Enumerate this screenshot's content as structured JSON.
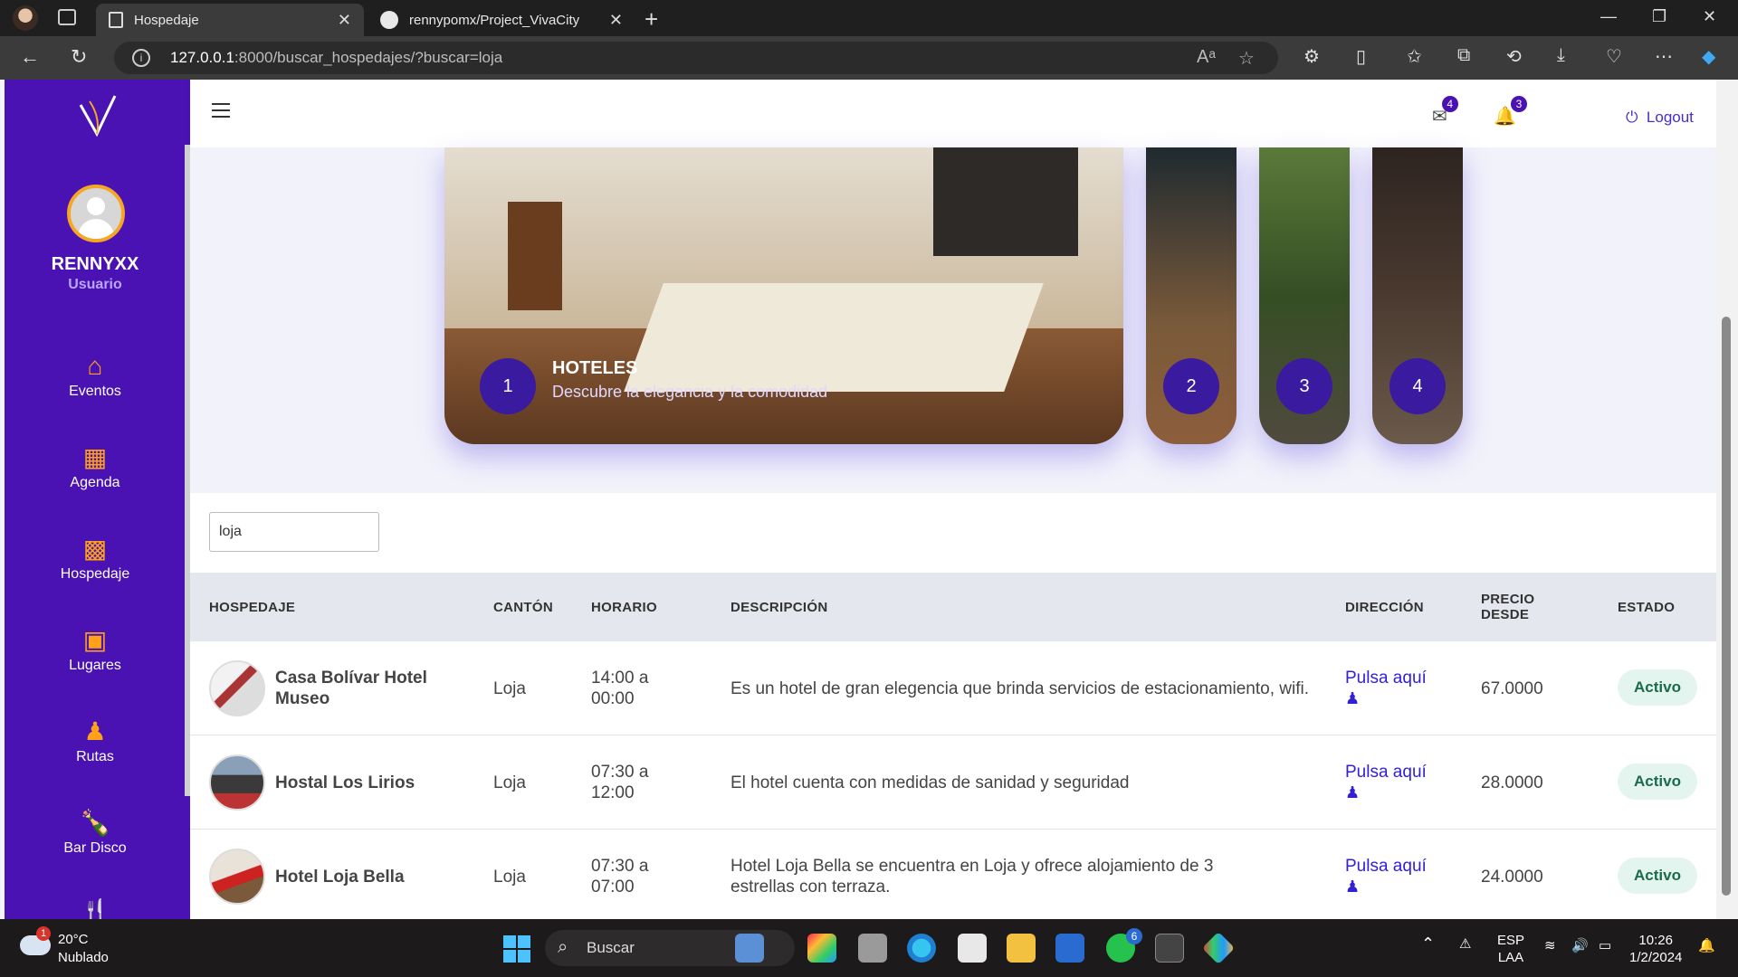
{
  "browser": {
    "tabs": [
      {
        "title": "Hospedaje",
        "active": true
      },
      {
        "title": "rennypomx/Project_VivaCity",
        "active": false
      }
    ],
    "url_host": "127.0.0.1",
    "url_path": ":8000/buscar_hospedajes/?buscar=loja"
  },
  "sidebar": {
    "user_name": "RENNYXX",
    "user_role": "Usuario",
    "items": [
      {
        "label": "Eventos",
        "icon": "home-icon"
      },
      {
        "label": "Agenda",
        "icon": "calendar-icon"
      },
      {
        "label": "Hospedaje",
        "icon": "building-icon"
      },
      {
        "label": "Lugares",
        "icon": "image-icon"
      },
      {
        "label": "Rutas",
        "icon": "route-icon"
      },
      {
        "label": "Bar Disco",
        "icon": "bottle-icon"
      }
    ]
  },
  "topbar": {
    "messages_count": "4",
    "notifications_count": "3",
    "logout_label": "Logout"
  },
  "hero": {
    "title": "HOTELES",
    "subtitle": "Descubre la elegancia y la comodidad",
    "slides": [
      "1",
      "2",
      "3",
      "4"
    ]
  },
  "search": {
    "value": "loja"
  },
  "table": {
    "headers": [
      "HOSPEDAJE",
      "CANTÓN",
      "HORARIO",
      "DESCRIPCIÓN",
      "DIRECCIÓN",
      "PRECIO DESDE",
      "ESTADO"
    ],
    "rows": [
      {
        "name": "Casa Bolívar Hotel Museo",
        "canton": "Loja",
        "horario": "14:00 a 00:00",
        "descripcion": "Es un hotel de gran elegencia que brinda servicios de estacionamiento, wifi.",
        "direccion": "Pulsa aquí",
        "precio": "67.0000",
        "estado": "Activo"
      },
      {
        "name": "Hostal Los Lirios",
        "canton": "Loja",
        "horario": "07:30 a 12:00",
        "descripcion": "El hotel cuenta con medidas de sanidad y seguridad",
        "direccion": "Pulsa aquí",
        "precio": "28.0000",
        "estado": "Activo"
      },
      {
        "name": "Hotel Loja Bella",
        "canton": "Loja",
        "horario": "07:30 a 07:00",
        "descripcion": "Hotel Loja Bella se encuentra en Loja y ofrece alojamiento de 3 estrellas con terraza.",
        "direccion": "Pulsa aquí",
        "precio": "24.0000",
        "estado": "Activo"
      }
    ]
  },
  "taskbar": {
    "weather_temp": "20°C",
    "weather_cond": "Nublado",
    "weather_badge": "1",
    "search_label": "Buscar",
    "lang": "ESP",
    "layout": "LAA",
    "time": "10:26",
    "date": "1/2/2024",
    "whatsapp_badge": "6"
  }
}
